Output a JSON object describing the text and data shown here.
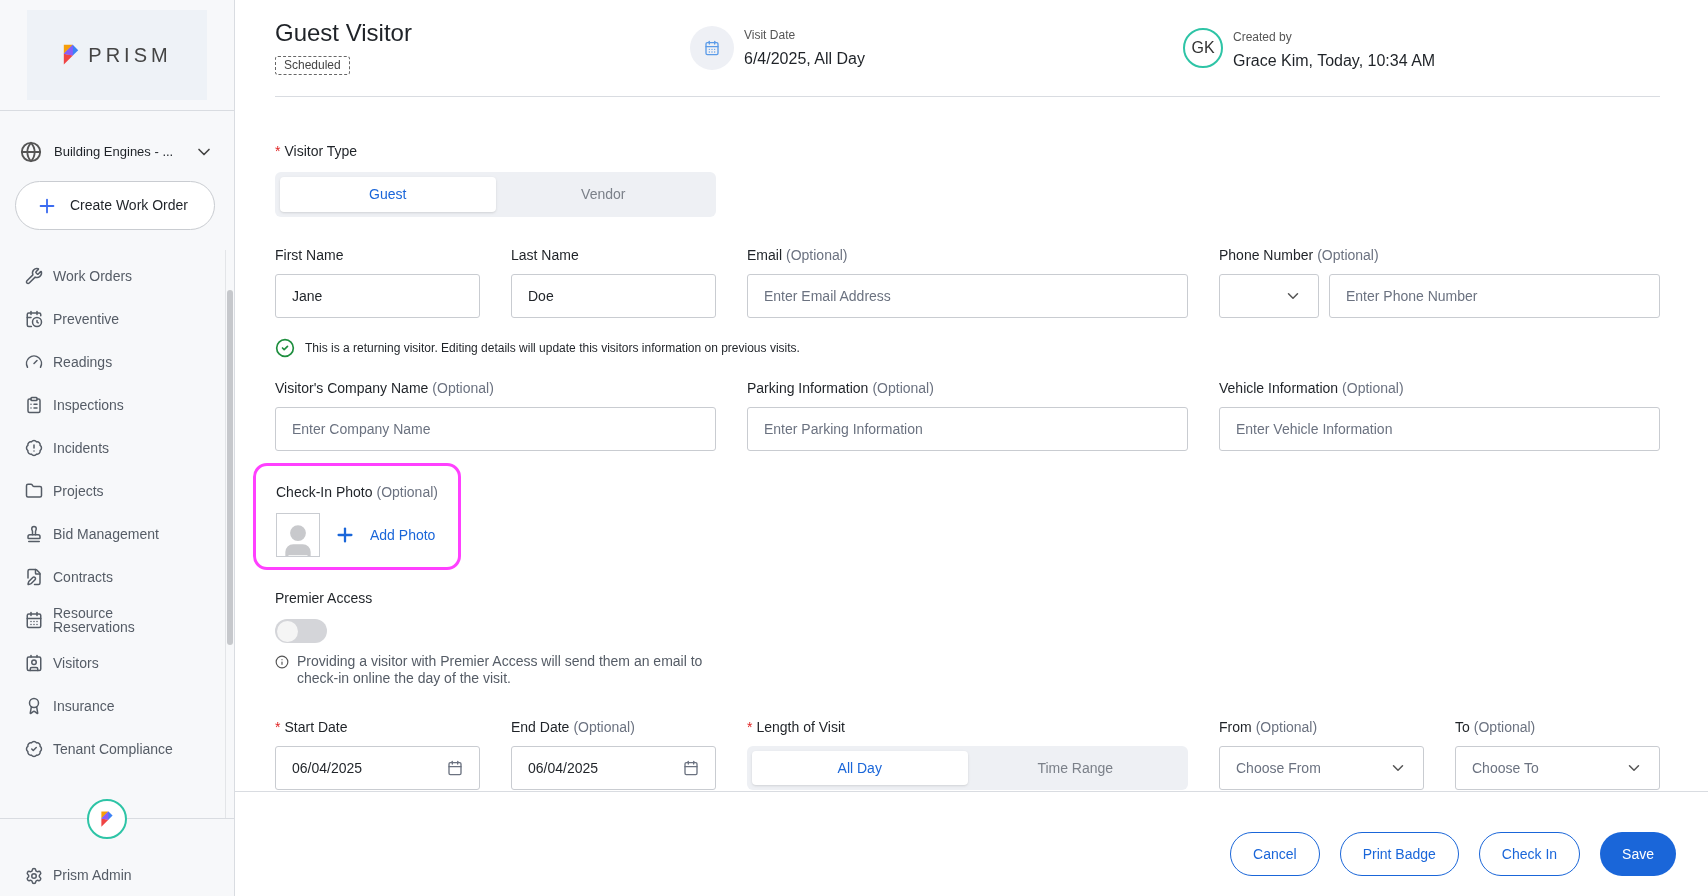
{
  "sidebar": {
    "logo_text": "PRISM",
    "building": "Building Engines - ...",
    "create_button": "Create Work Order",
    "nav_items": [
      {
        "label": "Work Orders"
      },
      {
        "label": "Preventive"
      },
      {
        "label": "Readings"
      },
      {
        "label": "Inspections"
      },
      {
        "label": "Incidents"
      },
      {
        "label": "Projects"
      },
      {
        "label": "Bid Management"
      },
      {
        "label": "Contracts"
      },
      {
        "label": "Resource Reservations"
      },
      {
        "label": "Visitors"
      },
      {
        "label": "Insurance"
      },
      {
        "label": "Tenant Compliance"
      }
    ],
    "admin_item": "Prism Admin"
  },
  "header": {
    "title": "Guest Visitor",
    "status": "Scheduled",
    "visit_date_label": "Visit Date",
    "visit_date": "6/4/2025, All Day",
    "created_by_label": "Created by",
    "creator_initials": "GK",
    "created_by": "Grace Kim, Today, 10:34 AM"
  },
  "visitor_type": {
    "label": "Visitor Type",
    "required_mark": "*",
    "options": [
      {
        "label": "Guest",
        "selected": true
      },
      {
        "label": "Vendor",
        "selected": false
      }
    ]
  },
  "fields_row_1": [
    {
      "kind": "text",
      "label": "First Name",
      "value": "Jane"
    },
    {
      "kind": "text",
      "label": "Last Name",
      "value": "Doe"
    },
    {
      "kind": "text",
      "label": "Email",
      "optional_note": "(Optional)",
      "placeholder": "Enter Email Address"
    },
    {
      "kind": "phone",
      "label": "Phone Number",
      "optional_note": "(Optional)",
      "placeholder": "Enter Phone Number"
    }
  ],
  "returning_notice": "This is a returning visitor. Editing details will update this visitors information on previous visits.",
  "fields_row_2": [
    {
      "kind": "text",
      "label": "Visitor's Company Name",
      "optional_note": "(Optional)",
      "placeholder": "Enter Company Name"
    },
    {
      "kind": "text",
      "label": "Parking Information",
      "optional_note": "(Optional)",
      "placeholder": "Enter Parking Information"
    },
    {
      "kind": "text",
      "label": "Vehicle Information",
      "optional_note": "(Optional)",
      "placeholder": "Enter Vehicle Information"
    }
  ],
  "check_in_photo": {
    "label": "Check-In Photo",
    "optional_note": "(Optional)",
    "button": "Add Photo",
    "highlighted": true
  },
  "premier_access": {
    "label": "Premier Access",
    "on": false,
    "info": "Providing a visitor with Premier Access will send them an email to check-in online the day of the visit."
  },
  "fields_row_3": [
    {
      "kind": "date",
      "label": "Start Date",
      "required_mark": "*",
      "value": "06/04/2025"
    },
    {
      "kind": "date",
      "label": "End Date",
      "optional_note": "(Optional)",
      "value": "06/04/2025"
    },
    {
      "kind": "segmented",
      "label": "Length of Visit",
      "required_mark": "*",
      "options": [
        {
          "label": "All Day",
          "selected": true
        },
        {
          "label": "Time Range",
          "selected": false
        }
      ]
    },
    {
      "kind": "select",
      "label": "From",
      "optional_note": "(Optional)",
      "placeholder": "Choose From"
    },
    {
      "kind": "select",
      "label": "To",
      "optional_note": "(Optional)",
      "placeholder": "Choose To"
    }
  ],
  "footer_buttons": [
    {
      "label": "Cancel",
      "primary": false
    },
    {
      "label": "Print Badge",
      "primary": false
    },
    {
      "label": "Check In",
      "primary": false
    },
    {
      "label": "Save",
      "primary": true
    }
  ]
}
